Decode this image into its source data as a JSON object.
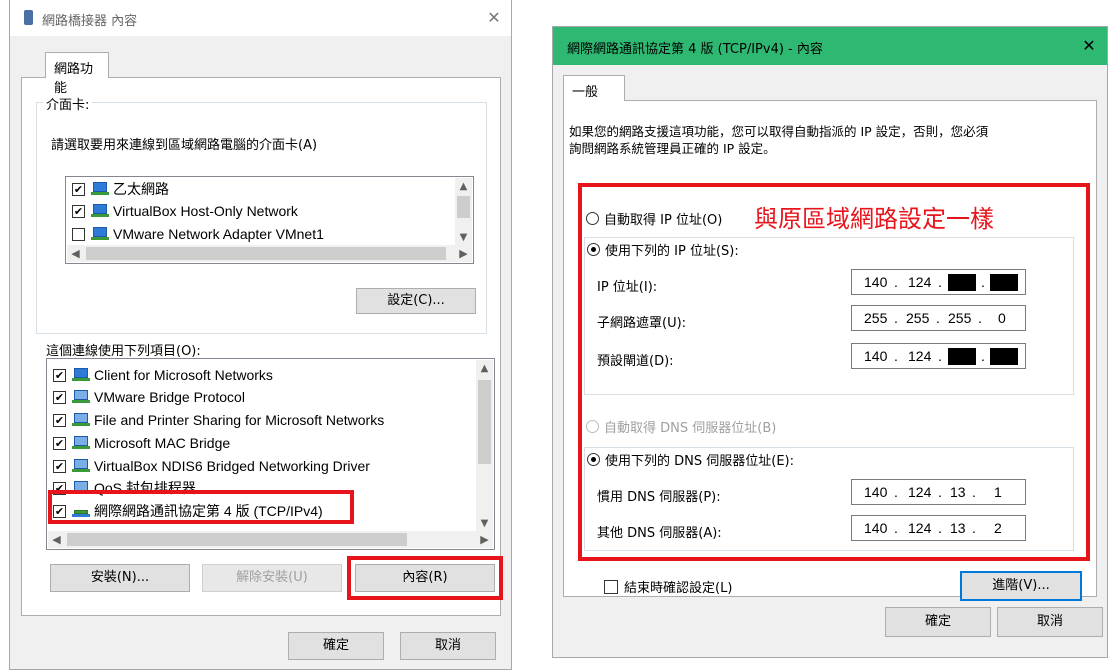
{
  "left_dialog": {
    "title": "網路橋接器 內容",
    "tab": "網路功能",
    "adapter_group_label": "介面卡:",
    "adapter_instruction": "請選取要用來連線到區域網路電腦的介面卡(A)",
    "adapters": [
      {
        "label": "乙太網路",
        "checked": true
      },
      {
        "label": "VirtualBox Host-Only Network",
        "checked": true
      },
      {
        "label": "VMware Network Adapter VMnet1",
        "checked": false
      }
    ],
    "config_button": "設定(C)...",
    "items_label": "這個連線使用下列項目(O):",
    "items": [
      {
        "label": "Client for Microsoft Networks",
        "checked": true,
        "icon": "network-client-icon"
      },
      {
        "label": "VMware Bridge Protocol",
        "checked": true,
        "icon": "protocol-icon"
      },
      {
        "label": "File and Printer Sharing for Microsoft Networks",
        "checked": true,
        "icon": "network-service-icon"
      },
      {
        "label": "Microsoft MAC Bridge",
        "checked": true,
        "icon": "protocol-icon"
      },
      {
        "label": "VirtualBox NDIS6 Bridged Networking Driver",
        "checked": true,
        "icon": "protocol-icon"
      },
      {
        "label": "QoS 封包排程器",
        "checked": true,
        "icon": "protocol-icon"
      },
      {
        "label": "網際網路通訊協定第 4 版 (TCP/IPv4)",
        "checked": true,
        "icon": "protocol-icon"
      }
    ],
    "install_button": "安裝(N)...",
    "uninstall_button": "解除安裝(U)",
    "properties_button": "內容(R)",
    "ok_button": "確定",
    "cancel_button": "取消"
  },
  "right_dialog": {
    "title": "網際網路通訊協定第 4 版 (TCP/IPv4) - 內容",
    "title_bar_color": "#2eb872",
    "tab": "一般",
    "description_line1": "如果您的網路支援這項功能，您可以取得自動指派的 IP 設定，否則，您必須",
    "description_line2": "詢問網路系統管理員正確的 IP 設定。",
    "annotation": "與原區域網路設定一樣",
    "auto_ip_radio": "自動取得 IP 位址(O)",
    "manual_ip_radio": "使用下列的 IP 位址(S):",
    "ip_label": "IP 位址(I):",
    "ip_visible": [
      "140",
      "124"
    ],
    "subnet_label": "子網路遮罩(U):",
    "subnet_value": [
      "255",
      "255",
      "255",
      "0"
    ],
    "gateway_label": "預設閘道(D):",
    "gateway_visible": [
      "140",
      "124"
    ],
    "auto_dns_radio": "自動取得 DNS 伺服器位址(B)",
    "manual_dns_radio": "使用下列的 DNS 伺服器位址(E):",
    "preferred_dns_label": "慣用 DNS 伺服器(P):",
    "preferred_dns": [
      "140",
      "124",
      "13",
      "1"
    ],
    "alternate_dns_label": "其他 DNS 伺服器(A):",
    "alternate_dns": [
      "140",
      "124",
      "13",
      "2"
    ],
    "validate_checkbox": "結束時確認設定(L)",
    "advanced_button": "進階(V)...",
    "ok_button": "確定",
    "cancel_button": "取消"
  },
  "colors": {
    "highlight_red": "#e8141b",
    "annotation_red": "#e8141b"
  }
}
